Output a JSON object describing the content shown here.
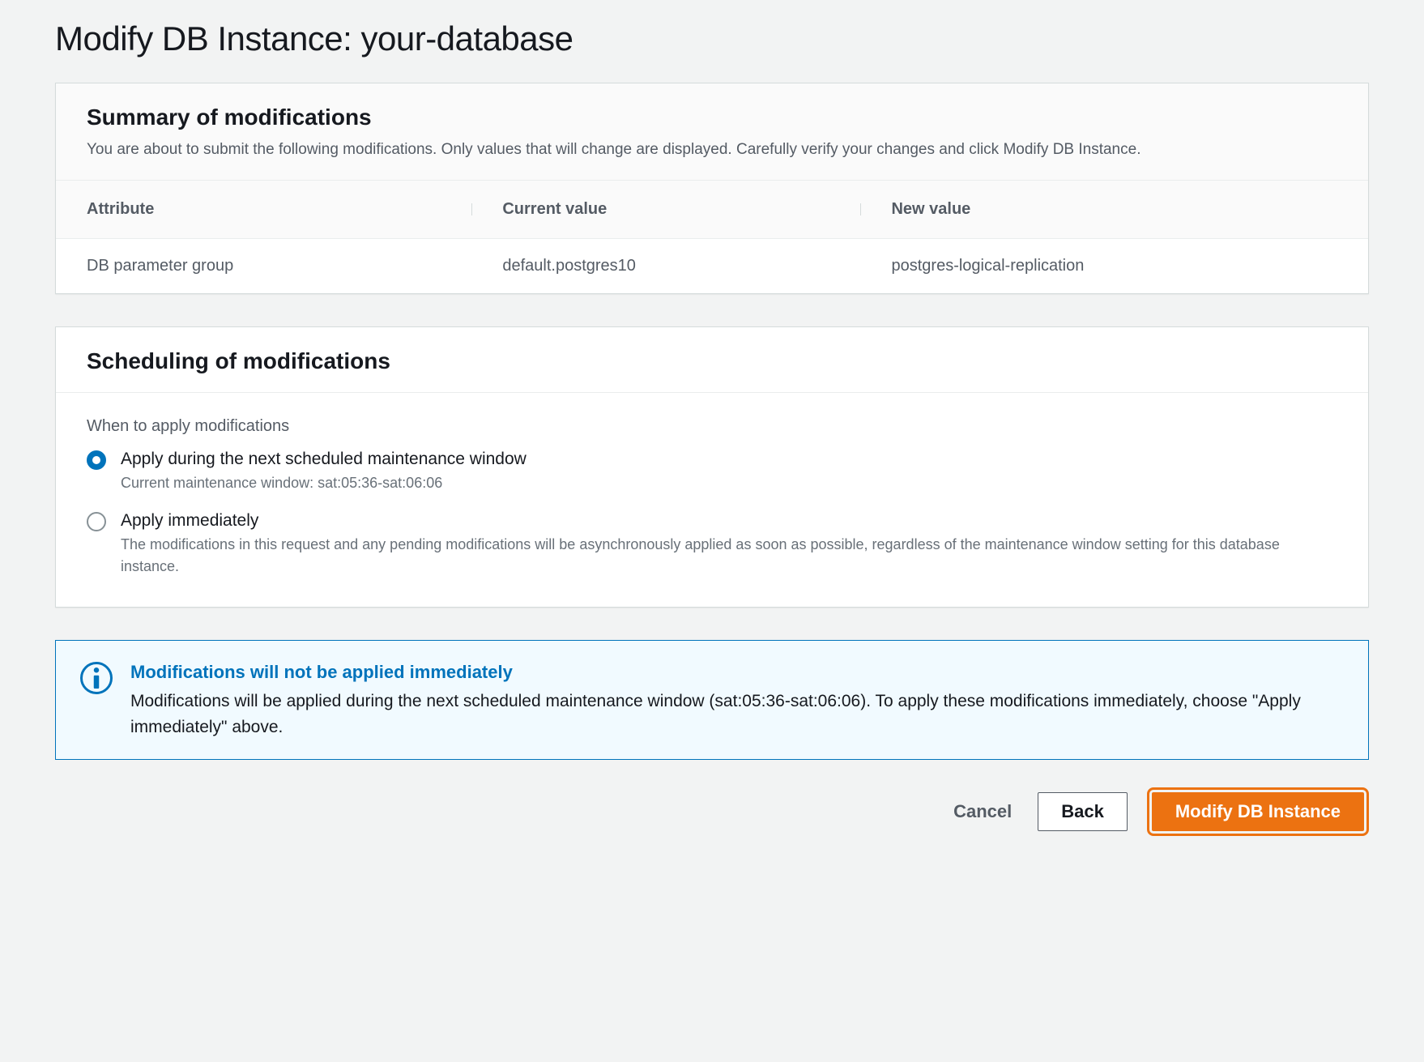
{
  "page_title": "Modify DB Instance: your-database",
  "summary": {
    "title": "Summary of modifications",
    "description": "You are about to submit the following modifications. Only values that will change are displayed. Carefully verify your changes and click Modify DB Instance.",
    "columns": {
      "attribute": "Attribute",
      "current": "Current value",
      "new": "New value"
    },
    "rows": [
      {
        "attribute": "DB parameter group",
        "current": "default.postgres10",
        "new": "postgres-logical-replication"
      }
    ]
  },
  "scheduling": {
    "title": "Scheduling of modifications",
    "field_label": "When to apply modifications",
    "options": [
      {
        "label": "Apply during the next scheduled maintenance window",
        "sub": "Current maintenance window: sat:05:36-sat:06:06",
        "checked": true
      },
      {
        "label": "Apply immediately",
        "sub": "The modifications in this request and any pending modifications will be asynchronously applied as soon as possible, regardless of the maintenance window setting for this database instance.",
        "checked": false
      }
    ]
  },
  "info": {
    "title": "Modifications will not be applied immediately",
    "body": "Modifications will be applied during the next scheduled maintenance window (sat:05:36-sat:06:06). To apply these modifications immediately, choose \"Apply immediately\" above."
  },
  "actions": {
    "cancel": "Cancel",
    "back": "Back",
    "submit": "Modify DB Instance"
  }
}
